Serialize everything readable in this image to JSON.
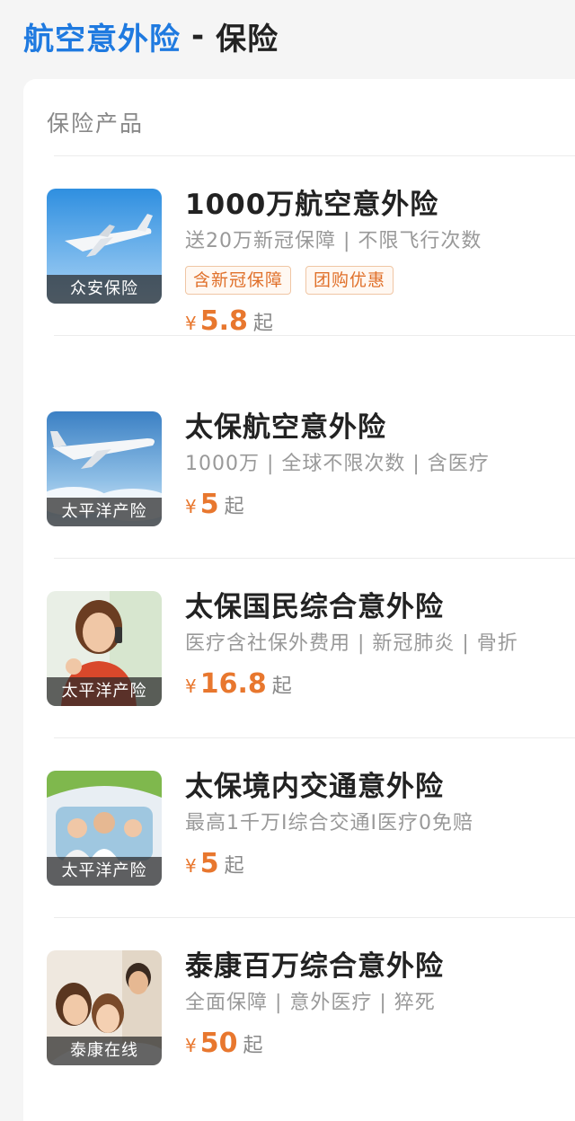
{
  "header": {
    "keyword": "航空意外险",
    "separator": "-",
    "category": "保险"
  },
  "section": {
    "title": "保险产品"
  },
  "products": [
    {
      "provider": "众安保险",
      "title": "1000万航空意外险",
      "subtitle": "送20万新冠保障 | 不限飞行次数",
      "tags": [
        "含新冠保障",
        "团购优惠"
      ],
      "currency": "¥",
      "price": "5.8",
      "price_suffix": "起",
      "thumb_icon": "airplane-photo-icon"
    },
    {
      "provider": "太平洋产险",
      "title": "太保航空意外险",
      "subtitle": "1000万 | 全球不限次数 | 含医疗",
      "tags": [],
      "currency": "¥",
      "price": "5",
      "price_suffix": "起",
      "thumb_icon": "airplane-clouds-photo-icon"
    },
    {
      "provider": "太平洋产险",
      "title": "太保国民综合意外险",
      "subtitle": "医疗含社保外费用 | 新冠肺炎 | 骨折",
      "tags": [],
      "currency": "¥",
      "price": "16.8",
      "price_suffix": "起",
      "thumb_icon": "woman-phone-photo-icon"
    },
    {
      "provider": "太平洋产险",
      "title": "太保境内交通意外险",
      "subtitle": "最高1千万I综合交通I医疗0免赔",
      "tags": [],
      "currency": "¥",
      "price": "5",
      "price_suffix": "起",
      "thumb_icon": "family-car-photo-icon"
    },
    {
      "provider": "泰康在线",
      "title": "泰康百万综合意外险",
      "subtitle": "全面保障 | 意外医疗 | 猝死",
      "tags": [],
      "currency": "¥",
      "price": "50",
      "price_suffix": "起",
      "thumb_icon": "family-photo-icon"
    }
  ],
  "colors": {
    "keyword": "#1f7ae0",
    "price": "#e8772e",
    "tag_text": "#e0702a"
  }
}
